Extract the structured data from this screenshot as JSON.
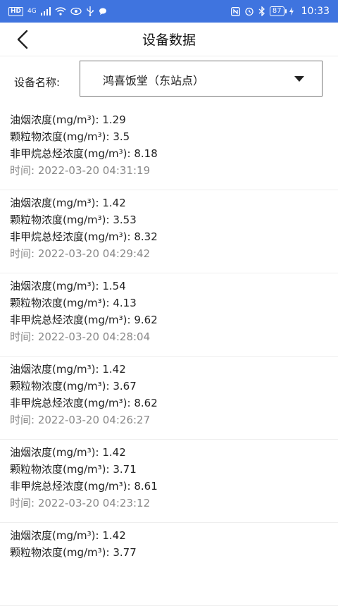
{
  "status_bar": {
    "network_badge": "HD",
    "network_type": "4G",
    "battery": "87",
    "time": "10:33"
  },
  "header": {
    "title": "设备数据"
  },
  "device": {
    "label": "设备名称:",
    "selected": "鸿喜饭堂（东站点）"
  },
  "fields": {
    "oil_smoke": "油烟浓度(mg/m³): ",
    "particulate": "颗粒物浓度(mg/m³): ",
    "nmhc": "非甲烷总烃浓度(mg/m³): ",
    "time": "时间: "
  },
  "records": [
    {
      "oil_smoke": "1.29",
      "particulate": "3.5",
      "nmhc": "8.18",
      "time": "2022-03-20 04:31:19"
    },
    {
      "oil_smoke": "1.42",
      "particulate": "3.53",
      "nmhc": "8.32",
      "time": "2022-03-20 04:29:42"
    },
    {
      "oil_smoke": "1.54",
      "particulate": "4.13",
      "nmhc": "9.62",
      "time": "2022-03-20 04:28:04"
    },
    {
      "oil_smoke": "1.42",
      "particulate": "3.67",
      "nmhc": "8.62",
      "time": "2022-03-20 04:26:27"
    },
    {
      "oil_smoke": "1.42",
      "particulate": "3.71",
      "nmhc": "8.61",
      "time": "2022-03-20 04:23:12"
    },
    {
      "oil_smoke": "1.42",
      "particulate": "3.77"
    }
  ]
}
